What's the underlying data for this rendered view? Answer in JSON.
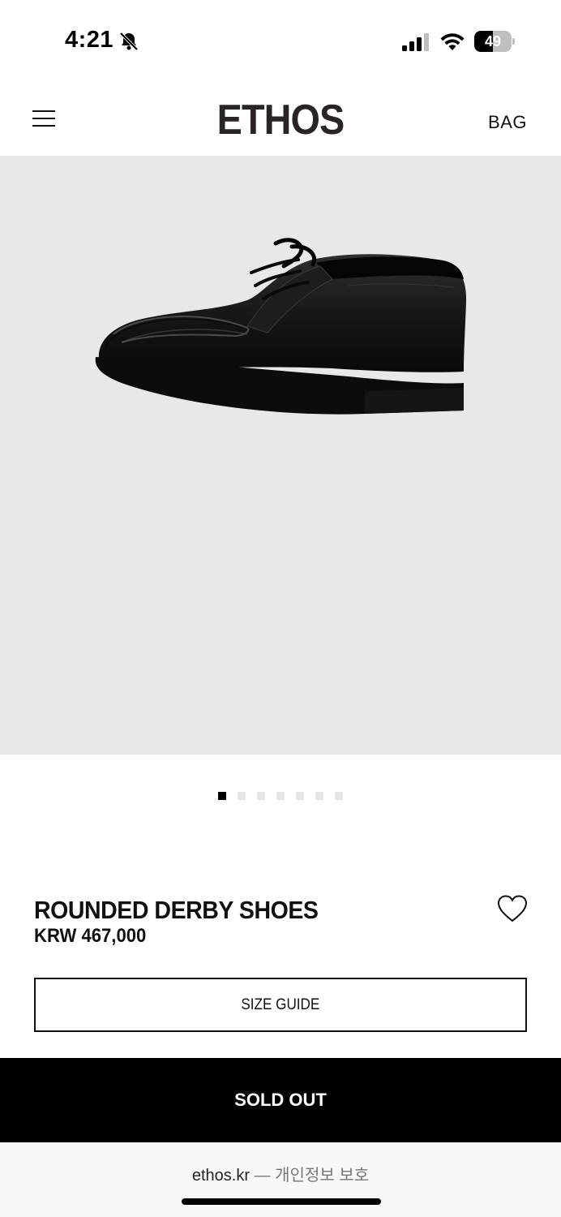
{
  "status_bar": {
    "time": "4:21",
    "battery": "49",
    "battery_level": 0.49,
    "icons": [
      "bell-off-icon",
      "signal-icon",
      "wifi-icon",
      "battery-icon"
    ]
  },
  "header": {
    "logo": "ETHOS",
    "bag_label": "BAG",
    "menu_icon": "hamburger-menu-icon"
  },
  "product": {
    "image_description_icon": "derby-shoe",
    "image_count": 7,
    "active_image_index": 0,
    "name": "ROUNDED DERBY SHOES",
    "price": "KRW 467,000",
    "wishlist_icon": "heart-outline-icon",
    "size_guide_label": "SIZE GUIDE",
    "sold_out_label": "SOLD OUT"
  },
  "browser": {
    "domain": "ethos.kr",
    "separator": "—",
    "privacy_label": "개인정보 보호"
  },
  "colors": {
    "image_background": "#eae8e6",
    "logo": "#2a2424",
    "sold_out_bg": "#000000"
  }
}
